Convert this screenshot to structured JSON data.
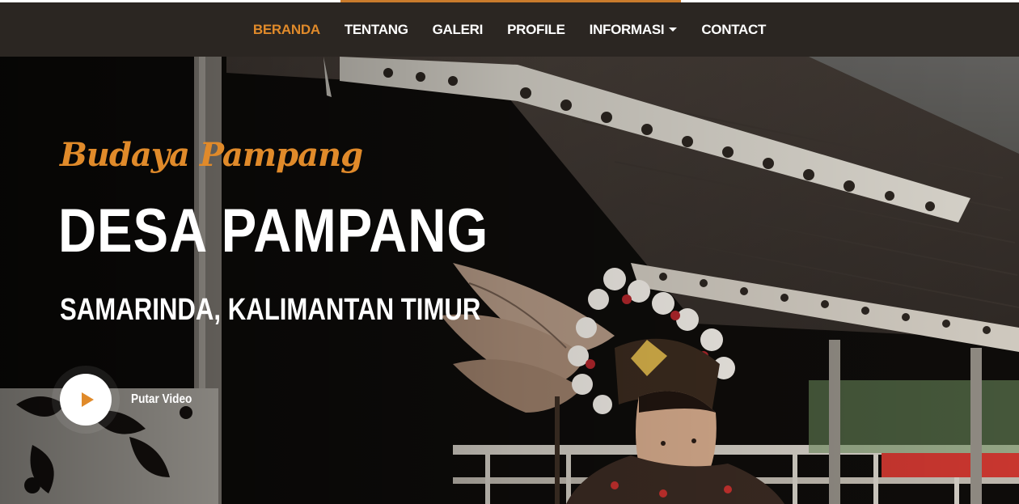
{
  "nav": {
    "items": [
      {
        "label": "BERANDA",
        "active": true
      },
      {
        "label": "TENTANG",
        "active": false
      },
      {
        "label": "GALERI",
        "active": false
      },
      {
        "label": "PROFILE",
        "active": false
      },
      {
        "label": "INFORMASI",
        "active": false,
        "dropdown": true
      },
      {
        "label": "CONTACT",
        "active": false
      }
    ]
  },
  "hero": {
    "tagline": "Budaya Pampang",
    "title": "DESA PAMPANG",
    "subtitle": "SAMARINDA, KALIMANTAN TIMUR",
    "play_label": "Putar Video",
    "play_icon": "play-icon",
    "background_image": "longhouse-dancer-photo"
  },
  "colors": {
    "accent": "#e08a2a",
    "navbar_bg": "#2b2622",
    "text_light": "#ffffff"
  }
}
